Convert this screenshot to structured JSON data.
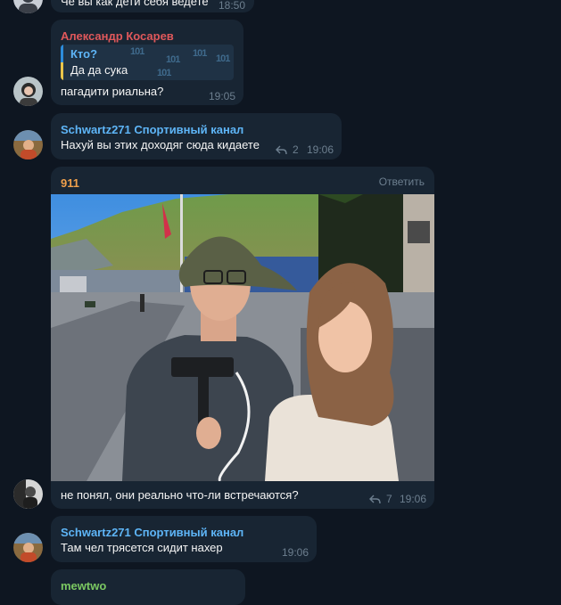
{
  "messages": {
    "m0": {
      "text": "Че вы как дети себя ведете",
      "time": "18:50"
    },
    "m1": {
      "sender": "Александр Косарев",
      "sender_color": "#e0585b",
      "quote_author": "Кто?",
      "quote_text": "Да да сука",
      "quote_pattern": "101",
      "text": "пагадити риальна?",
      "time": "19:05"
    },
    "m2": {
      "sender": "Schwartz271 Спортивный канал",
      "sender_color": "#5eb5f7",
      "text": "Нахуй вы этих доходяг сюда кидаете",
      "replies": "2",
      "time": "19:06"
    },
    "m3": {
      "sender": "911",
      "sender_color": "#f0a04b",
      "reply_label": "Ответить",
      "text": "не понял, они реально что-ли встречаются?",
      "replies": "7",
      "time": "19:06"
    },
    "m4": {
      "sender": "Schwartz271 Спортивный канал",
      "sender_color": "#5eb5f7",
      "text": "Там чел трясется сидит нахер",
      "time": "19:06"
    },
    "m5": {
      "sender": "mewtwo",
      "sender_color": "#7bc862"
    }
  },
  "icons": {
    "reply": "reply-arrow-icon"
  }
}
